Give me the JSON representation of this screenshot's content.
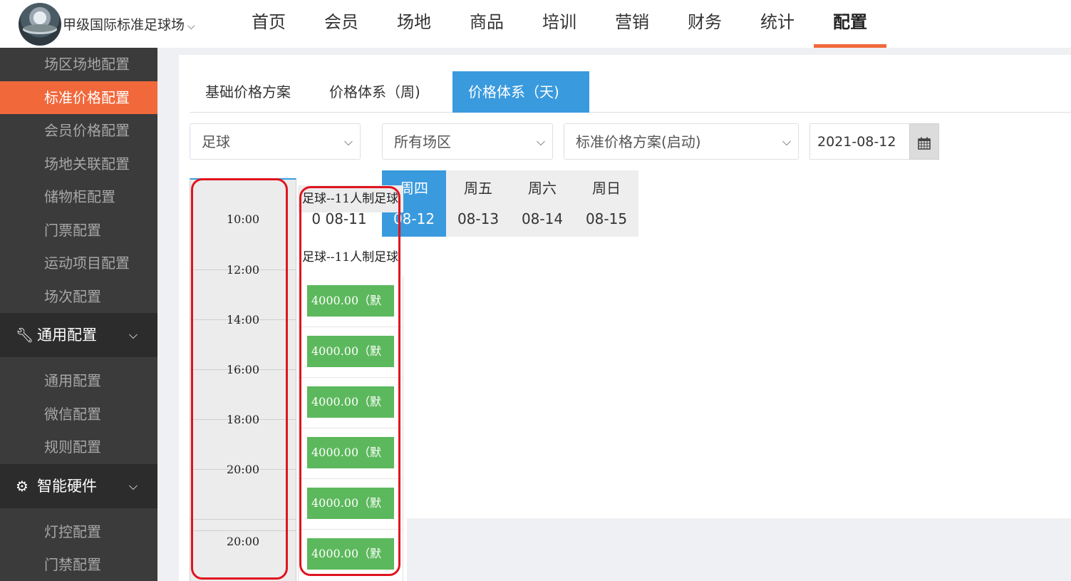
{
  "header": {
    "venue_name": "甲级国际标准足球场",
    "nav": [
      "首页",
      "会员",
      "场地",
      "商品",
      "培训",
      "营销",
      "财务",
      "统计",
      "配置"
    ],
    "active_nav": "配置"
  },
  "sidebar": {
    "items_top": [
      "场区场地配置",
      "标准价格配置",
      "会员价格配置",
      "场地关联配置",
      "储物柜配置",
      "门票配置",
      "运动项目配置",
      "场次配置"
    ],
    "active_item": "标准价格配置",
    "group_general": {
      "label": "通用配置",
      "icon": "wrench-icon"
    },
    "items_general": [
      "通用配置",
      "微信配置",
      "规则配置"
    ],
    "group_hardware": {
      "label": "智能硬件",
      "icon": "gear-icon"
    },
    "items_hardware": [
      "灯控配置",
      "门禁配置"
    ]
  },
  "tabs": [
    "基础价格方案",
    "价格体系（周)",
    "价格体系（天)"
  ],
  "active_tab": "价格体系（天)",
  "filters": {
    "sport": "足球",
    "area": "所有场区",
    "plan": "标准价格方案(启动)",
    "date": "2021-08-12"
  },
  "days": [
    {
      "name": "周四",
      "date": "08-12",
      "active": true
    },
    {
      "name": "周五",
      "date": "08-13",
      "active": false
    },
    {
      "name": "周六",
      "date": "08-14",
      "active": false
    },
    {
      "name": "周日",
      "date": "08-15",
      "active": false
    }
  ],
  "prev_day_date": "0  08-11",
  "time_labels": [
    "10:00",
    "12:00",
    "14:00",
    "16:00",
    "18:00",
    "20:00",
    "20:00"
  ],
  "field_name": "足球--11人制足球",
  "prices": [
    "4000.00（默",
    "4000.00（默",
    "4000.00（默",
    "4000.00（默",
    "4000.00（默",
    "4000.00（默"
  ],
  "colors": {
    "accent": "#f1683b",
    "tab_active": "#3a9ade",
    "price_green": "#5cb85c",
    "sidebar_bg": "#3b3b3b",
    "annotation": "#e0141e"
  }
}
